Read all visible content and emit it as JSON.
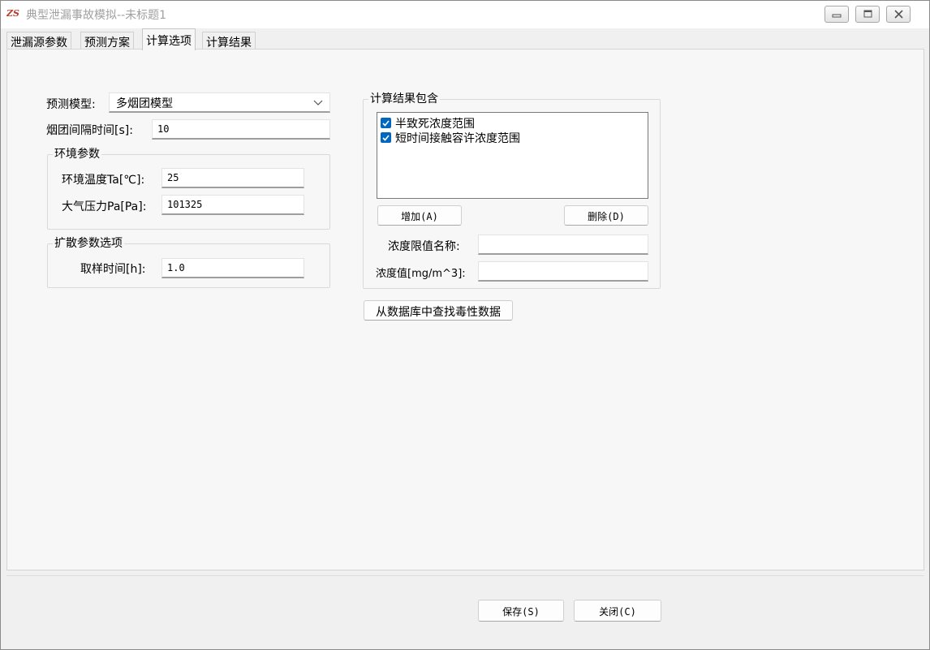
{
  "window": {
    "title": "典型泄漏事故模拟--未标题1",
    "logo_text": "ZS"
  },
  "tabs": [
    {
      "label": "泄漏源参数",
      "active": false
    },
    {
      "label": "预测方案",
      "active": false
    },
    {
      "label": "计算选项",
      "active": true
    },
    {
      "label": "计算结果",
      "active": false
    }
  ],
  "model": {
    "label": "预测模型:",
    "value": "多烟团模型"
  },
  "puff_interval": {
    "label": "烟团间隔时间[s]:",
    "value": "10"
  },
  "environment": {
    "title": "环境参数",
    "temp_label": "环境温度Ta[℃]:",
    "temp_value": "25",
    "pressure_label": "大气压力Pa[Pa]:",
    "pressure_value": "101325"
  },
  "diffusion": {
    "title": "扩散参数选项",
    "sampling_label": "取样时间[h]:",
    "sampling_value": "1.0"
  },
  "results": {
    "title": "计算结果包含",
    "items": [
      {
        "label": "半致死浓度范围",
        "checked": true
      },
      {
        "label": "短时间接触容许浓度范围",
        "checked": true
      }
    ],
    "add_label": "增加(A)",
    "delete_label": "删除(D)",
    "limit_name_label": "浓度限值名称:",
    "limit_name_value": "",
    "conc_label": "浓度值[mg/m^3]:",
    "conc_value": ""
  },
  "lookup_label": "从数据库中查找毒性数据",
  "footer": {
    "save_label": "保存(S)",
    "close_label": "关闭(C)"
  },
  "colors": {
    "accent": "#0067c0",
    "title_text": "#a0a0a0"
  }
}
